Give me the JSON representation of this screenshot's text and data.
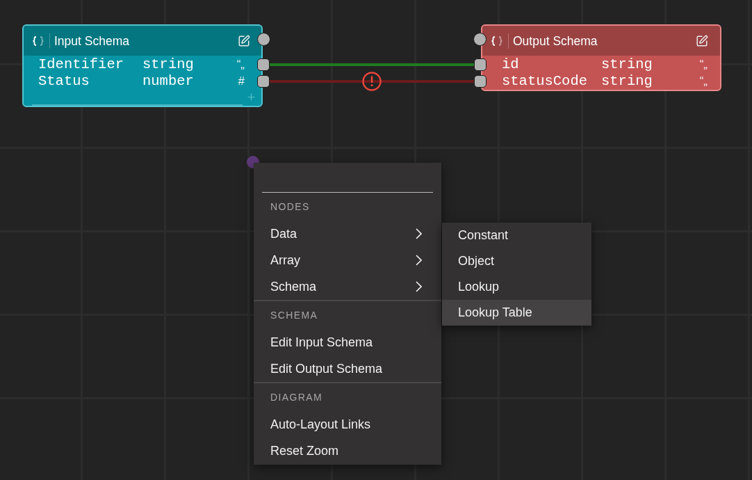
{
  "canvas": {
    "nodes": [
      {
        "kind": "input",
        "title": "Input Schema",
        "fields": [
          {
            "name": "Identifier",
            "type": "string",
            "glyph": "“„"
          },
          {
            "name": "Status",
            "type": "number",
            "glyph": "#"
          }
        ]
      },
      {
        "kind": "output",
        "title": "Output Schema",
        "fields": [
          {
            "name": "id",
            "type": "string",
            "glyph": "“„"
          },
          {
            "name": "statusCode",
            "type": "string",
            "glyph": "“„"
          }
        ]
      }
    ],
    "links": [
      {
        "error": false
      },
      {
        "error": true
      }
    ]
  },
  "context_menu": {
    "sections": [
      {
        "title": "NODES",
        "items": [
          {
            "label": "Data",
            "kind": "submenu"
          },
          {
            "label": "Array",
            "kind": "submenu"
          },
          {
            "label": "Schema",
            "kind": "submenu"
          }
        ]
      },
      {
        "title": "SCHEMA",
        "items": [
          {
            "label": "Edit Input Schema",
            "kind": "action"
          },
          {
            "label": "Edit Output Schema",
            "kind": "action"
          }
        ]
      },
      {
        "title": "DIAGRAM",
        "items": [
          {
            "label": "Auto-Layout Links",
            "kind": "action"
          },
          {
            "label": "Reset Zoom",
            "kind": "action"
          }
        ]
      }
    ]
  },
  "submenu": {
    "items": [
      {
        "label": "Constant",
        "selected": false
      },
      {
        "label": "Object",
        "selected": false
      },
      {
        "label": "Lookup",
        "selected": false
      },
      {
        "label": "Lookup Table",
        "selected": true
      }
    ]
  }
}
